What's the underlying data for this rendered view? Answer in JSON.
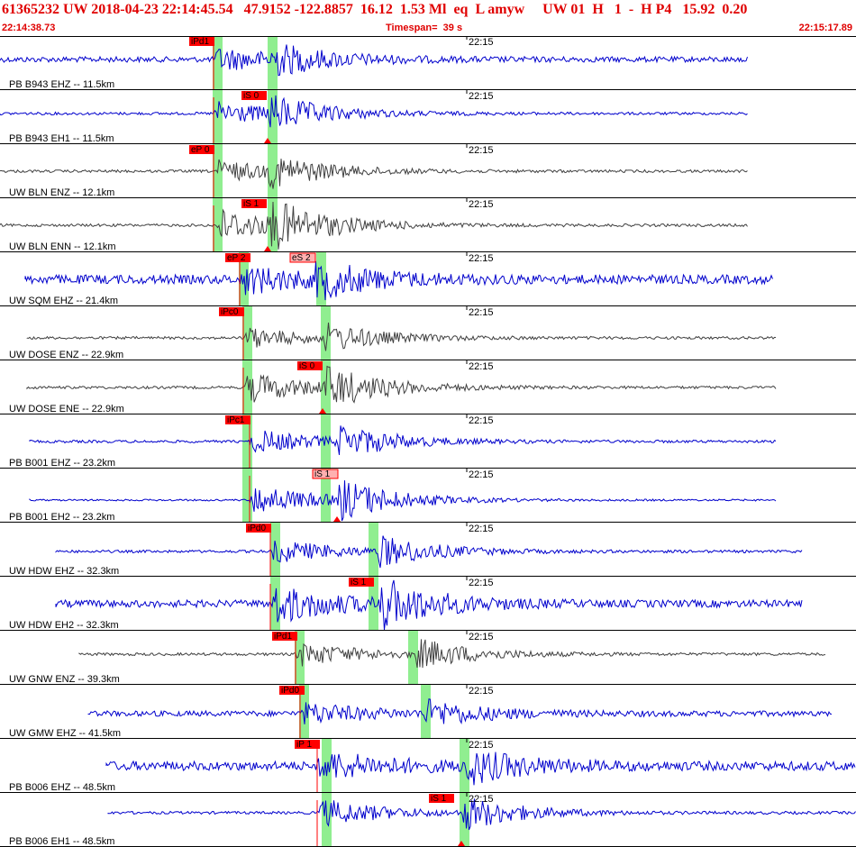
{
  "header": {
    "title": "61365232 UW 2018-04-23 22:14:45.54   47.9152 -122.8857  16.12  1.53 Ml  eq  L amyw     UW 01  H   1  -  H P4   15.92  0.20",
    "start_time": "22:14:38.73",
    "timespan": "Timespan=  39 s",
    "end_time": "22:15:17.89"
  },
  "colors": {
    "header_text": "#e00000",
    "trace_blue": "#0000cc",
    "trace_gray": "#404040",
    "pick_flag": "#ff0000",
    "pick_flag_light": "#ffb0b0",
    "window_green": "#90ee90"
  },
  "traces": [
    {
      "station": "PB B943 EHZ -- 11.5km",
      "color": "blue",
      "time_tick": "22:15",
      "pick": "iPd1",
      "pick_style": "solid",
      "arrow": false,
      "noise": 3,
      "event": 13
    },
    {
      "station": "PB B943 EH1 -- 11.5km",
      "color": "blue",
      "time_tick": "22:15",
      "pick": "iS 0",
      "pick_style": "solid",
      "arrow": true,
      "noise": 1.5,
      "event": 14
    },
    {
      "station": "UW BLN ENZ -- 12.1km",
      "color": "gray",
      "time_tick": "22:15",
      "pick": "eP 0",
      "pick_style": "solid",
      "arrow": false,
      "noise": 1.5,
      "event": 13
    },
    {
      "station": "UW BLN ENN -- 12.1km",
      "color": "gray",
      "time_tick": "22:15",
      "pick": "iS 1",
      "pick_style": "solid",
      "arrow": true,
      "noise": 1.5,
      "event": 20
    },
    {
      "station": "UW SQM EHZ -- 21.4km",
      "color": "blue",
      "time_tick": "22:15",
      "pick": "eP 2",
      "pick_style": "solid",
      "pick2": "eS 2",
      "arrow": false,
      "noise": 5,
      "event": 15
    },
    {
      "station": "UW DOSE ENZ -- 22.9km",
      "color": "gray",
      "time_tick": "22:15",
      "pick": "iPc0",
      "pick_style": "solid",
      "arrow": false,
      "noise": 1.5,
      "event": 12
    },
    {
      "station": "UW DOSE ENE -- 22.9km",
      "color": "gray",
      "time_tick": "22:15",
      "pick": "iS 0",
      "pick_style": "solid",
      "arrow": true,
      "noise": 1.5,
      "event": 18
    },
    {
      "station": "PB B001 EHZ -- 23.2km",
      "color": "blue",
      "time_tick": "22:15",
      "pick": "iPc1",
      "pick_style": "solid",
      "arrow": false,
      "noise": 1.5,
      "event": 14
    },
    {
      "station": "PB B001 EH2 -- 23.2km",
      "color": "blue",
      "time_tick": "22:15",
      "pick": "iS 1",
      "pick_style": "light",
      "arrow": true,
      "noise": 1,
      "event": 18
    },
    {
      "station": "UW HDW EHZ -- 32.3km",
      "color": "blue",
      "time_tick": "22:15",
      "pick": "iPd0",
      "pick_style": "solid",
      "arrow": false,
      "noise": 1.5,
      "event": 14
    },
    {
      "station": "UW HDW EH2 -- 32.3km",
      "color": "blue",
      "time_tick": "22:15",
      "pick": "iS 1",
      "pick_style": "solid",
      "arrow": false,
      "noise": 4,
      "event": 22
    },
    {
      "station": "UW GNW ENZ -- 39.3km",
      "color": "gray",
      "time_tick": "22:15",
      "pick": "iPd1",
      "pick_style": "solid",
      "arrow": false,
      "noise": 1.5,
      "event": 14
    },
    {
      "station": "UW GMW EHZ -- 41.5km",
      "color": "blue",
      "time_tick": "22:15",
      "pick": "iPd0",
      "pick_style": "solid",
      "arrow": false,
      "noise": 3,
      "event": 12
    },
    {
      "station": "PB B006 EHZ -- 48.5km",
      "color": "blue",
      "time_tick": "22:15",
      "pick": "iP 1",
      "pick_style": "solid",
      "arrow": false,
      "noise": 5,
      "event": 16
    },
    {
      "station": "PB B006 EH1 -- 48.5km",
      "color": "blue",
      "time_tick": "22:15",
      "pick": "iS 1",
      "pick_style": "solid",
      "arrow": true,
      "noise": 1.5,
      "event": 16
    }
  ]
}
